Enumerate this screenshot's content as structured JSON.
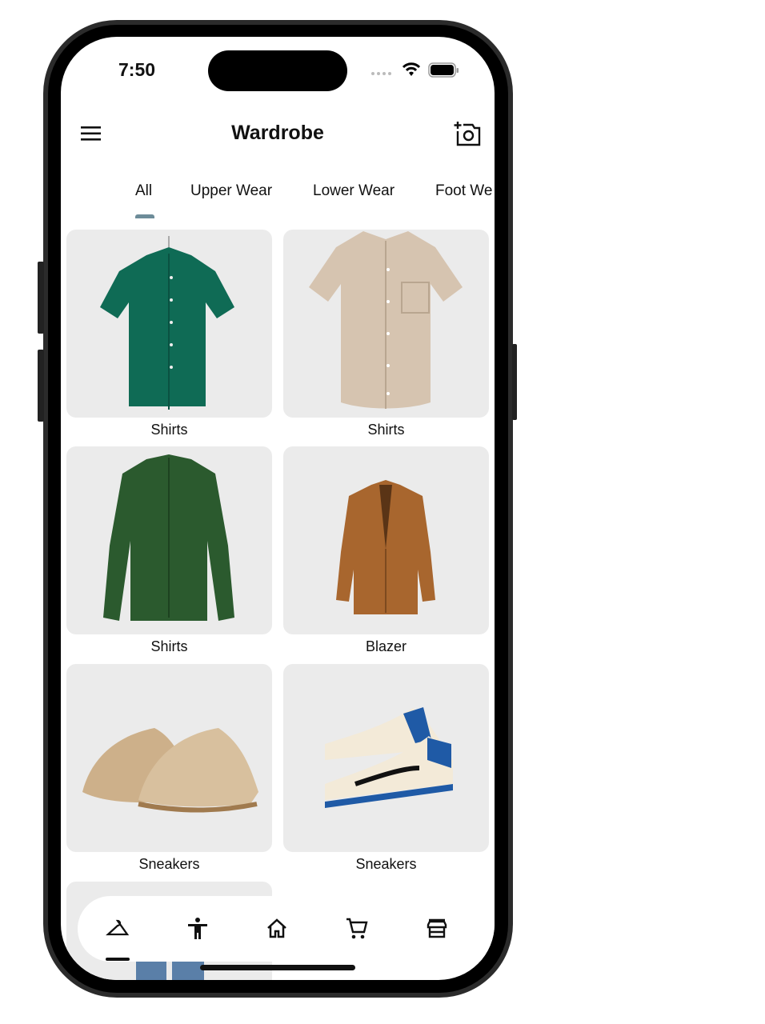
{
  "status_bar": {
    "time": "7:50"
  },
  "header": {
    "title": "Wardrobe",
    "menu_icon": "hamburger-menu-icon",
    "action_icon": "add-photo-camera-icon"
  },
  "tabs": [
    {
      "label": "All",
      "active": true
    },
    {
      "label": "Upper Wear",
      "active": false
    },
    {
      "label": "Lower Wear",
      "active": false
    },
    {
      "label": "Foot We",
      "active": false
    }
  ],
  "items": [
    {
      "label": "Shirts",
      "color": "#0f6b55"
    },
    {
      "label": "Shirts",
      "color": "#d6c4b0"
    },
    {
      "label": "Shirts",
      "color": "#2b5a2e"
    },
    {
      "label": "Blazer",
      "color": "#a8662e"
    },
    {
      "label": "Sneakers",
      "color": "#cdb08a"
    },
    {
      "label": "Sneakers",
      "color": "#1f5aa6"
    }
  ],
  "bottom_nav": [
    {
      "icon": "hanger-icon",
      "active": true
    },
    {
      "icon": "person-icon",
      "active": false
    },
    {
      "icon": "home-icon",
      "active": false
    },
    {
      "icon": "cart-icon",
      "active": false
    },
    {
      "icon": "store-icon",
      "active": false
    }
  ],
  "colors": {
    "tab_indicator": "#6d8c99",
    "card_bg": "#ebebeb"
  }
}
